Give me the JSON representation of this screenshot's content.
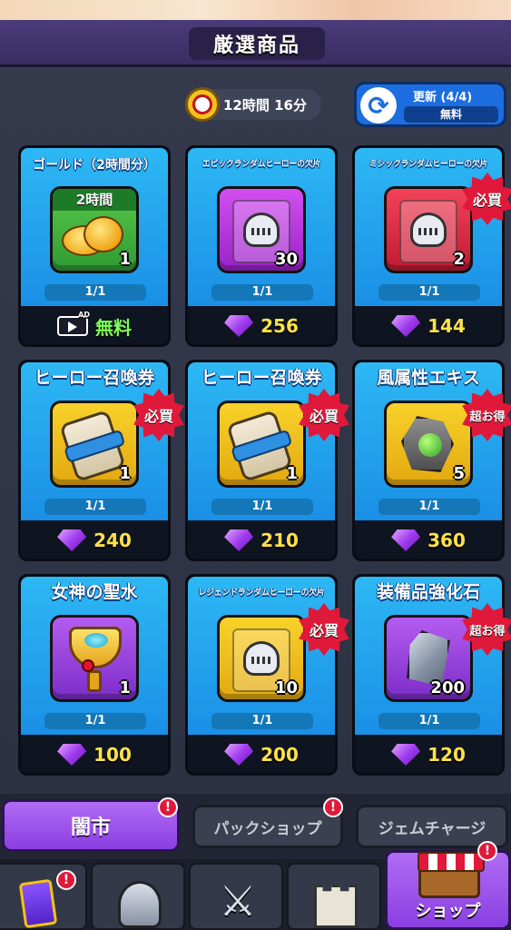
{
  "header": {
    "title": "厳選商品"
  },
  "timer": {
    "icon": "stopwatch-icon",
    "text": "12時間 16分"
  },
  "refresh": {
    "icon": "refresh-icon",
    "label": "更新 (4/4)",
    "cost": "無料"
  },
  "cards": [
    {
      "title": "ゴールド（2時間分）",
      "box_label": "2時間",
      "qty": "1",
      "stock": "1/1",
      "price": "無料",
      "price_type": "ad",
      "icon": "gold-coins-icon"
    },
    {
      "title": "エピックランダムヒーローの欠片",
      "qty": "30",
      "stock": "1/1",
      "price": "256",
      "price_type": "gem",
      "icon": "hero-shard-icon"
    },
    {
      "title": "ミシックランダムヒーローの欠片",
      "qty": "2",
      "stock": "1/1",
      "price": "144",
      "price_type": "gem",
      "badge": "必買",
      "icon": "hero-shard-icon"
    },
    {
      "title": "ヒーロー召喚券",
      "qty": "1",
      "stock": "1/1",
      "price": "240",
      "price_type": "gem",
      "badge": "必買",
      "icon": "summon-ticket-icon"
    },
    {
      "title": "ヒーロー召喚券",
      "qty": "1",
      "stock": "1/1",
      "price": "210",
      "price_type": "gem",
      "badge": "必買",
      "icon": "summon-ticket-icon"
    },
    {
      "title": "風属性エキス",
      "qty": "5",
      "stock": "1/1",
      "price": "360",
      "price_type": "gem",
      "badge": "超お得",
      "icon": "wind-essence-icon"
    },
    {
      "title": "女神の聖水",
      "qty": "1",
      "stock": "1/1",
      "price": "100",
      "price_type": "gem",
      "icon": "holy-water-icon"
    },
    {
      "title": "レジェンドランダムヒーローの欠片",
      "qty": "10",
      "stock": "1/1",
      "price": "200",
      "price_type": "gem",
      "badge": "必買",
      "icon": "hero-shard-icon"
    },
    {
      "title": "装備品強化石",
      "qty": "200",
      "stock": "1/1",
      "price": "120",
      "price_type": "gem",
      "badge": "超お得",
      "icon": "enhance-stone-icon"
    }
  ],
  "tabs": [
    {
      "label": "闇市",
      "alert": "!"
    },
    {
      "label": "パックショップ",
      "alert": "!"
    },
    {
      "label": "ジェムチャージ"
    }
  ],
  "nav": [
    {
      "icon": "card-icon",
      "alert": "!"
    },
    {
      "icon": "knight-helmet-icon"
    },
    {
      "icon": "crossed-swords-icon"
    },
    {
      "icon": "castle-icon"
    },
    {
      "icon": "shop-stall-icon",
      "label": "ショップ",
      "alert": "!"
    }
  ],
  "colors": {
    "accent": "#8a3fe0",
    "card": "#1a8fe6",
    "price": "#ffe14a",
    "free": "#7fff5a",
    "badge": "#e0193a"
  }
}
